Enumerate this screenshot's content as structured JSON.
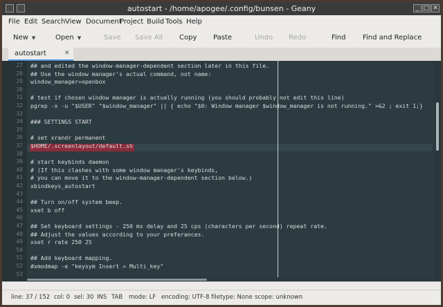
{
  "window": {
    "title": "autostart - /home/apogee/.config/bunsen - Geany"
  },
  "menubar": {
    "items": [
      "File",
      "Edit",
      "Search",
      "View",
      "Document",
      "Project",
      "Build",
      "Tools",
      "Help"
    ]
  },
  "toolbar": {
    "new": "New",
    "open": "Open",
    "save": "Save",
    "save_all": "Save All",
    "copy": "Copy",
    "paste": "Paste",
    "undo": "Undo",
    "redo": "Redo",
    "find": "Find",
    "find_replace": "Find and Replace"
  },
  "tabs": [
    {
      "label": "autostart",
      "close": "✕"
    }
  ],
  "editor": {
    "lines": [
      {
        "num": "27",
        "text": "## and edited the window-manager-dependent section later in this file."
      },
      {
        "num": "28",
        "text": "## Use the window manager's actual command, not name:"
      },
      {
        "num": "29",
        "text": "window_manager=openbox"
      },
      {
        "num": "30",
        "text": ""
      },
      {
        "num": "31",
        "text": "# test if chosen window manager is actually running (you should probably not edit this line)"
      },
      {
        "num": "32",
        "text": "pgrep -x -u \"$USER\" \"$window_manager\" || { echo \"$0: Window manager $window_manager is not running.\" >&2 ; exit 1;}"
      },
      {
        "num": "33",
        "text": ""
      },
      {
        "num": "34",
        "text": "### SETTINGS START"
      },
      {
        "num": "35",
        "text": ""
      },
      {
        "num": "36",
        "text": "# set xrandr permanent"
      },
      {
        "num": "37",
        "text": "$HOME/.screenlayout/default.sh"
      },
      {
        "num": "38",
        "text": ""
      },
      {
        "num": "39",
        "text": "# start keybinds daemon"
      },
      {
        "num": "40",
        "text": "# (If this clashes with some window manager's keybinds,"
      },
      {
        "num": "41",
        "text": "# you can move it to the window-manager-dependent section below.)"
      },
      {
        "num": "42",
        "text": "xbindkeys_autostart"
      },
      {
        "num": "43",
        "text": ""
      },
      {
        "num": "44",
        "text": "## Turn on/off system beep."
      },
      {
        "num": "45",
        "text": "xset b off"
      },
      {
        "num": "46",
        "text": ""
      },
      {
        "num": "47",
        "text": "## Set keyboard settings - 250 ms delay and 25 cps (characters per second) repeat rate."
      },
      {
        "num": "48",
        "text": "## Adjust the values according to your preferances."
      },
      {
        "num": "49",
        "text": "xset r rate 250 25"
      },
      {
        "num": "50",
        "text": ""
      },
      {
        "num": "51",
        "text": "## Add keyboard mapping."
      },
      {
        "num": "52",
        "text": "#xmodmap -e \"keysym Insert = Multi_key\""
      },
      {
        "num": "53",
        "text": ""
      }
    ]
  },
  "statusbar": {
    "line": "line: 37 / 152",
    "col": "col: 0",
    "sel": "sel: 30",
    "ins": "INS",
    "tab": "TAB",
    "mode": "mode: LF",
    "encoding": "encoding: UTF-8",
    "filetype": "filetype: None",
    "scope": "scope: unknown"
  },
  "colors": {
    "editor_bg": "#2c3b40",
    "selection": "#8b2c3a",
    "titlebar": "#3b3b3b"
  }
}
